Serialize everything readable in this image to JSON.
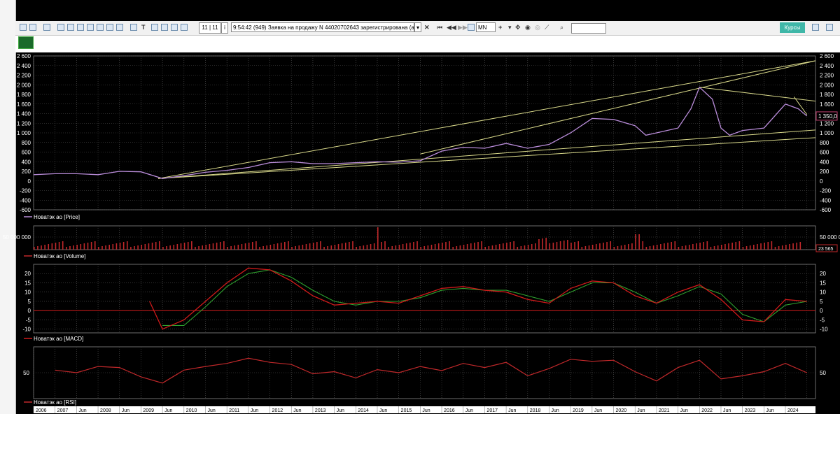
{
  "toolbar": {
    "counter": "11 | 11",
    "news_text": "9:54:42  (949) Заявка на продажу N 44020702643 зарегистрирована (аукцион с",
    "timeframe": "MN",
    "kursy_label": "Курсы"
  },
  "colors": {
    "price": "#b98cd9",
    "volume": "#c0282a",
    "macd": "#d01a1a",
    "signal": "#2ea02e",
    "rsi": "#c0282a",
    "trend": "#d9d98a",
    "axis": "#ffffff",
    "grid": "#555555",
    "bg": "#000000"
  },
  "chart_data": [
    {
      "type": "line",
      "title": "",
      "legend": "Новатэк ао [Price]",
      "ylim": [
        -600,
        2600
      ],
      "yticks": [
        "2 600",
        "2 400",
        "2 200",
        "2 000",
        "1 800",
        "1 600",
        "1 400",
        "1 200",
        "1 000",
        "800",
        "600",
        "400",
        "200",
        "0",
        "-200",
        "-400",
        "-600"
      ],
      "last_value": "1 350,0",
      "x": [
        2006,
        2006.5,
        2007,
        2007.5,
        2008,
        2008.5,
        2009,
        2009.5,
        2010,
        2010.5,
        2011,
        2011.5,
        2012,
        2012.5,
        2013,
        2013.5,
        2014,
        2014.5,
        2015,
        2015.5,
        2016,
        2016.5,
        2017,
        2017.5,
        2018,
        2018.5,
        2019,
        2019.5,
        2020,
        2020.25,
        2020.5,
        2021,
        2021.3,
        2021.5,
        2021.8,
        2022,
        2022.2,
        2022.5,
        2023,
        2023.5,
        2023.8,
        2024
      ],
      "values": [
        130,
        150,
        150,
        130,
        200,
        190,
        50,
        110,
        180,
        220,
        280,
        380,
        400,
        360,
        360,
        380,
        400,
        390,
        420,
        620,
        700,
        680,
        780,
        680,
        760,
        1000,
        1300,
        1280,
        1150,
        950,
        1000,
        1100,
        1500,
        1950,
        1700,
        1100,
        950,
        1050,
        1100,
        1600,
        1500,
        1350
      ]
    },
    {
      "type": "bar",
      "title": "",
      "legend": "Новатэк ао [Volume]",
      "ytick": "50 000 000",
      "last_value": "23 565"
    },
    {
      "type": "line",
      "title": "",
      "legend": "Новатэк ао [MACD]",
      "ylim": [
        -12,
        25
      ],
      "yticks": [
        "20",
        "15",
        "10",
        "5",
        "0",
        "-5",
        "-10"
      ],
      "x": [
        2008.7,
        2009,
        2009.5,
        2010,
        2010.5,
        2011,
        2011.5,
        2012,
        2012.5,
        2013,
        2013.5,
        2014,
        2014.5,
        2015,
        2015.5,
        2016,
        2016.5,
        2017,
        2017.5,
        2018,
        2018.5,
        2019,
        2019.5,
        2020,
        2020.5,
        2021,
        2021.5,
        2022,
        2022.5,
        2023,
        2023.5,
        2024
      ],
      "series": [
        {
          "values": [
            5,
            -10,
            -5,
            5,
            15,
            23,
            22,
            16,
            8,
            3,
            4,
            5,
            4,
            8,
            12,
            13,
            11,
            10,
            6,
            4,
            12,
            16,
            15,
            8,
            4,
            10,
            14,
            6,
            -5,
            -6,
            6,
            5
          ]
        },
        {
          "values": [
            null,
            -8,
            -8,
            2,
            13,
            20,
            22,
            18,
            11,
            5,
            3,
            5,
            5,
            7,
            11,
            12,
            11,
            11,
            8,
            5,
            10,
            15,
            15,
            10,
            4,
            8,
            13,
            9,
            -2,
            -6,
            3,
            5
          ]
        }
      ]
    },
    {
      "type": "line",
      "title": "",
      "legend": "Новатэк ао [RSI]",
      "ytick": "50",
      "x": [
        2006.5,
        2007,
        2007.5,
        2008,
        2008.5,
        2009,
        2009.5,
        2010,
        2010.5,
        2011,
        2011.5,
        2012,
        2012.5,
        2013,
        2013.5,
        2014,
        2014.5,
        2015,
        2015.5,
        2016,
        2016.5,
        2017,
        2017.5,
        2018,
        2018.5,
        2019,
        2019.5,
        2020,
        2020.5,
        2021,
        2021.5,
        2022,
        2022.5,
        2023,
        2023.5,
        2024
      ],
      "values": [
        55,
        50,
        62,
        60,
        42,
        30,
        55,
        62,
        68,
        78,
        70,
        66,
        48,
        52,
        40,
        56,
        50,
        62,
        54,
        68,
        60,
        70,
        44,
        58,
        76,
        72,
        74,
        52,
        34,
        60,
        74,
        38,
        44,
        52,
        68,
        50
      ]
    }
  ],
  "xaxis_labels": [
    "2006",
    "2007",
    "Jun",
    "2008",
    "Jun",
    "2009",
    "Jun",
    "2010",
    "Jun",
    "2011",
    "Jun",
    "2012",
    "Jun",
    "2013",
    "Jun",
    "2014",
    "Jun",
    "2015",
    "Jun",
    "2016",
    "Jun",
    "2017",
    "Jun",
    "2018",
    "Jun",
    "2019",
    "Jun",
    "2020",
    "Jun",
    "2021",
    "Jun",
    "2022",
    "Jun",
    "2023",
    "Jun",
    "2024"
  ]
}
